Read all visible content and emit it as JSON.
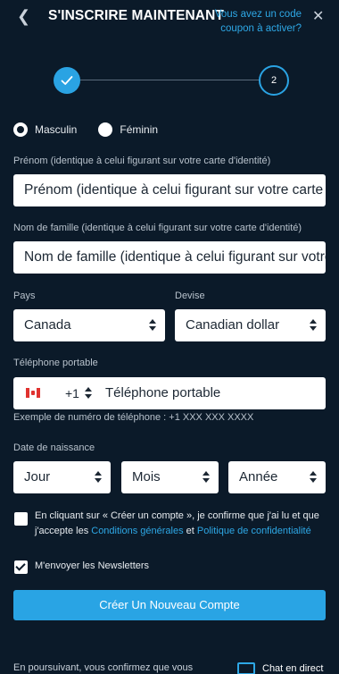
{
  "header": {
    "title": "S'INSCRIRE MAINTENANT",
    "coupon_line1": "Vous avez un code",
    "coupon_line2": "coupon à activer?",
    "back_icon": "chevron-left-icon",
    "close_icon": "close-icon"
  },
  "stepper": {
    "step1_icon": "check-icon",
    "step2_label": "2",
    "active_color": "#2aa3e3"
  },
  "gender": {
    "options": [
      "Masculin",
      "Féminin"
    ],
    "selected": "Masculin"
  },
  "first_name": {
    "label": "Prénom (identique à celui figurant sur votre carte d'identité)",
    "placeholder": "Prénom (identique à celui figurant sur votre carte d'identité)"
  },
  "last_name": {
    "label": "Nom de famille (identique à celui figurant sur votre carte d'identité)",
    "placeholder": "Nom de famille (identique à celui figurant sur votre carte d'identité)"
  },
  "country": {
    "label": "Pays",
    "value": "Canada"
  },
  "currency": {
    "label": "Devise",
    "value": "Canadian dollar"
  },
  "phone": {
    "label": "Téléphone portable",
    "dial_code": "+1",
    "placeholder": "Téléphone portable",
    "flag_icon": "canada-flag-icon",
    "hint": "Exemple de numéro de téléphone : +1 XXX XXX XXXX"
  },
  "birthdate": {
    "label": "Date de naissance",
    "day": "Jour",
    "month": "Mois",
    "year": "Année"
  },
  "terms": {
    "text_before": "En cliquant sur « Créer un compte », je confirme que j'ai lu et que j'accepte les ",
    "link1": "Conditions générales",
    "text_middle": " et ",
    "link2": "Politique de confidentialité",
    "checked": false
  },
  "newsletter": {
    "label": "M'envoyer les Newsletters",
    "checked": true
  },
  "submit": {
    "label": "Créer Un Nouveau Compte"
  },
  "footer": {
    "text": "En poursuivant, vous confirmez que vous",
    "chat_label": "Chat en direct"
  },
  "colors": {
    "background": "#0b1a29",
    "accent": "#29a4e4",
    "link": "#2ea8e6"
  }
}
